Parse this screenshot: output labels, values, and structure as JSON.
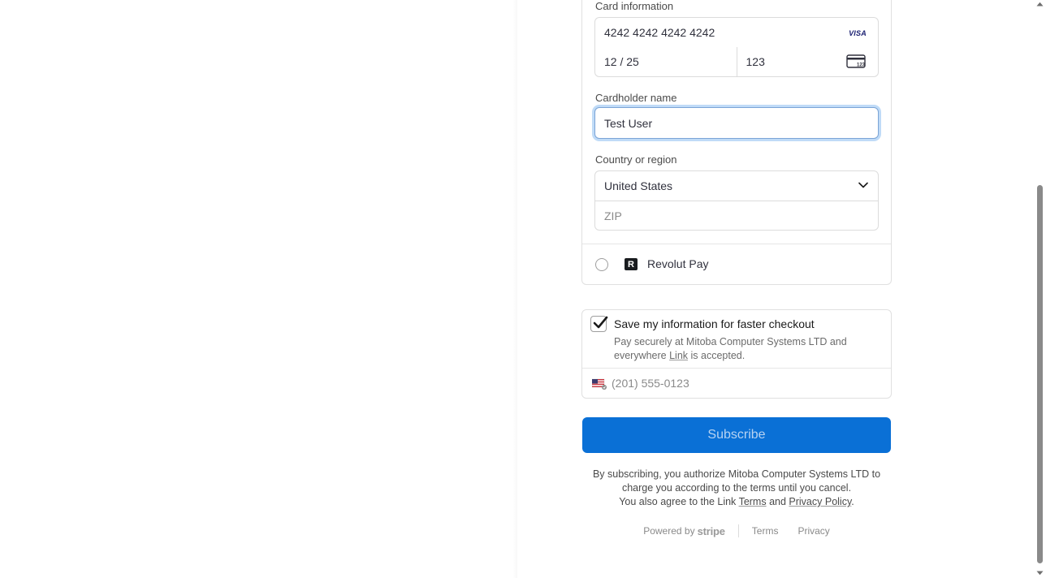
{
  "card_info": {
    "label": "Card information",
    "number": "4242 4242 4242 4242",
    "brand": "VISA",
    "expiry": "12 / 25",
    "cvc": "123",
    "cvc_icon_text": "123"
  },
  "cardholder": {
    "label": "Cardholder name",
    "value": "Test User"
  },
  "country": {
    "label": "Country or region",
    "selected": "United States",
    "zip_placeholder": "ZIP"
  },
  "revolut": {
    "label": "Revolut Pay",
    "logo_letter": "R"
  },
  "link_save": {
    "title": "Save my information for faster checkout",
    "desc_before": "Pay securely at Mitoba Computer Systems LTD and everywhere ",
    "desc_link": "Link",
    "desc_after": " is accepted.",
    "phone_placeholder": "(201) 555-0123",
    "checked": true
  },
  "subscribe": {
    "label": "Subscribe",
    "color": "#0a70d6"
  },
  "terms": {
    "line1": "By subscribing, you authorize Mitoba Computer Systems LTD to charge you according to the terms until you cancel.",
    "line2_before": "You also agree to the Link ",
    "terms_link": "Terms",
    "and": " and ",
    "privacy_link": "Privacy Policy",
    "end": "."
  },
  "footer": {
    "powered_by": "Powered by",
    "stripe": "stripe",
    "terms": "Terms",
    "privacy": "Privacy"
  }
}
